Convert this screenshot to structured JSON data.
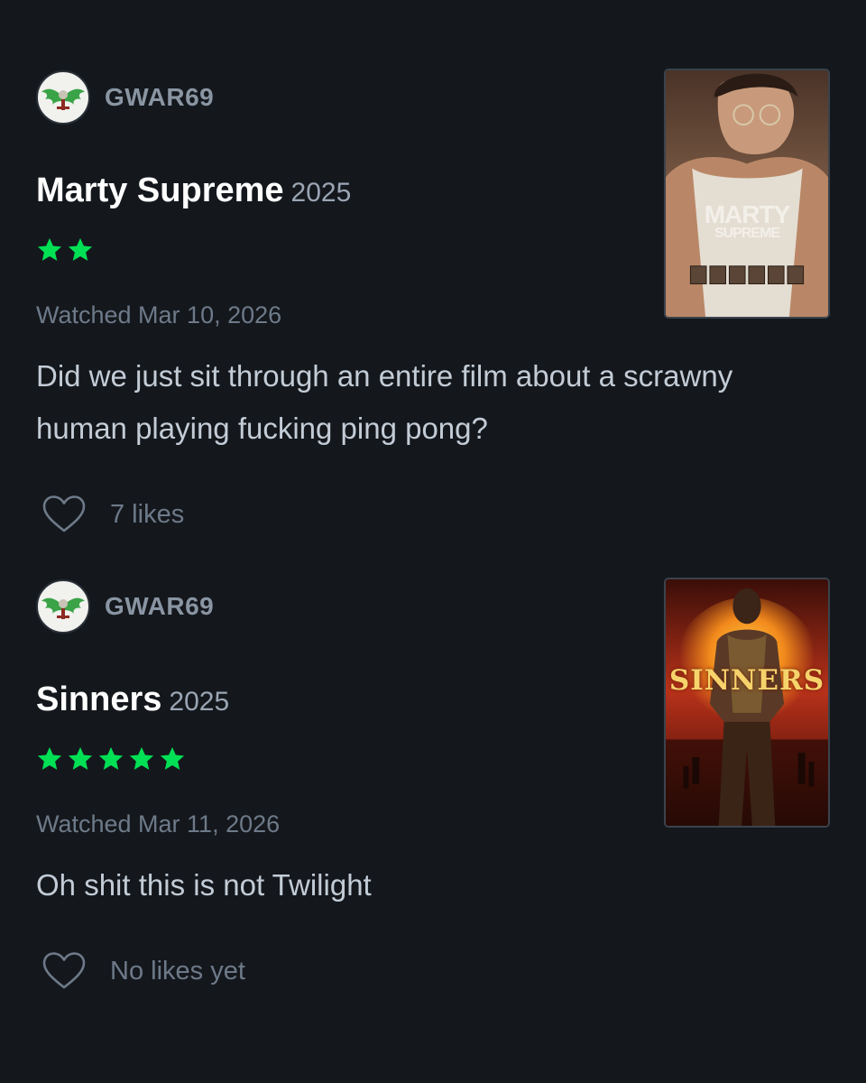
{
  "reviews": [
    {
      "username": "GWAR69",
      "film_title": "Marty Supreme",
      "year": "2025",
      "rating_stars": 2,
      "watched": "Watched Mar 10, 2026",
      "text": "Did we just sit through an entire film about a scrawny human playing fucking ping pong?",
      "likes": "7 likes",
      "poster": {
        "title_line1": "MARTY",
        "title_line2": "SUPREME"
      }
    },
    {
      "username": "GWAR69",
      "film_title": "Sinners",
      "year": "2025",
      "rating_stars": 5,
      "watched": "Watched Mar 11, 2026",
      "text": "Oh shit this is not Twilight",
      "likes": "No likes yet",
      "poster": {
        "title_line1": "SINNERS"
      }
    }
  ],
  "colors": {
    "background": "#14181d",
    "star": "#00e054",
    "username": "#8a95a3",
    "muted": "#6e7a89",
    "body_text": "#c3ccd6"
  },
  "icons": {
    "avatar": "winged-skull-logo-icon",
    "star": "star-icon",
    "like": "heart-outline-icon"
  }
}
